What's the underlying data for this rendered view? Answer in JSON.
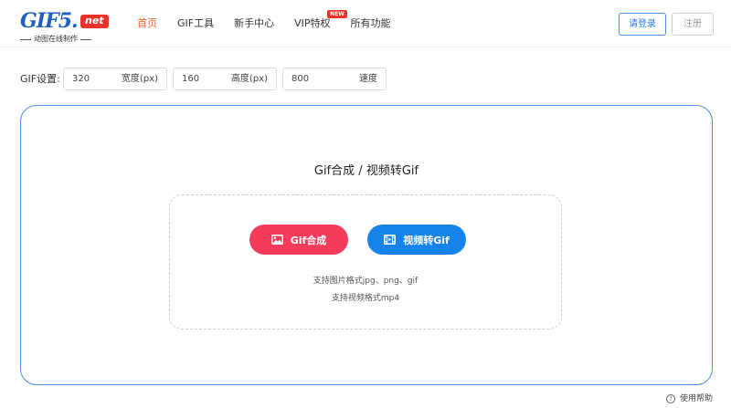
{
  "logo": {
    "brand": "GIF5",
    "dot": ".",
    "tld": "net",
    "tagline": "动图在线制作"
  },
  "nav": {
    "items": [
      {
        "label": "首页",
        "active": true
      },
      {
        "label": "GIF工具",
        "active": false
      },
      {
        "label": "新手中心",
        "active": false
      },
      {
        "label": "VIP特权",
        "active": false,
        "badge": "NEW"
      },
      {
        "label": "所有功能",
        "active": false
      }
    ]
  },
  "auth": {
    "login_label": "请登录",
    "register_label": "注册"
  },
  "settings": {
    "label": "GIF设置:",
    "width": {
      "value": "320",
      "unit": "宽度(px)"
    },
    "height": {
      "value": "160",
      "unit": "高度(px)"
    },
    "speed": {
      "value": "800",
      "unit": "速度"
    }
  },
  "main": {
    "title": "Gif合成 / 视频转Gif",
    "gif_button": "Gif合成",
    "video_button": "视频转Gif",
    "support_images": "支持图片格式jpg、png、gif",
    "support_video": "支持视频格式mp4"
  },
  "help": {
    "label": "使用帮助"
  },
  "colors": {
    "accent_blue": "#1683ea",
    "accent_red": "#f43b5a",
    "nav_active": "#e8632b"
  }
}
